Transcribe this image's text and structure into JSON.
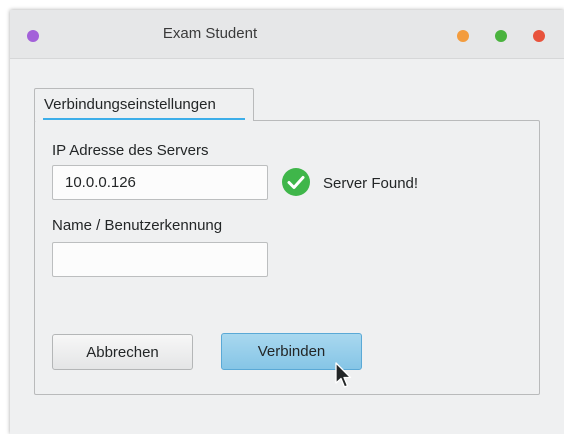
{
  "window": {
    "title": "Exam Student",
    "menu_dot_color": "#a361d9",
    "controls": [
      {
        "name": "minimize",
        "color": "#f39c3e"
      },
      {
        "name": "maximize",
        "color": "#4ab33e"
      },
      {
        "name": "close",
        "color": "#e8533c"
      }
    ]
  },
  "tabs": [
    {
      "label": "Verbindungseinstellungen",
      "active": true
    }
  ],
  "form": {
    "ip_label": "IP Adresse des Servers",
    "ip_value": "10.0.0.126",
    "status_icon": "check-circle-icon",
    "status_color": "#3fb64a",
    "status_text": "Server Found!",
    "name_label": "Name / Benutzerkennung",
    "name_value": ""
  },
  "buttons": {
    "cancel_label": "Abbrechen",
    "connect_label": "Verbinden"
  }
}
